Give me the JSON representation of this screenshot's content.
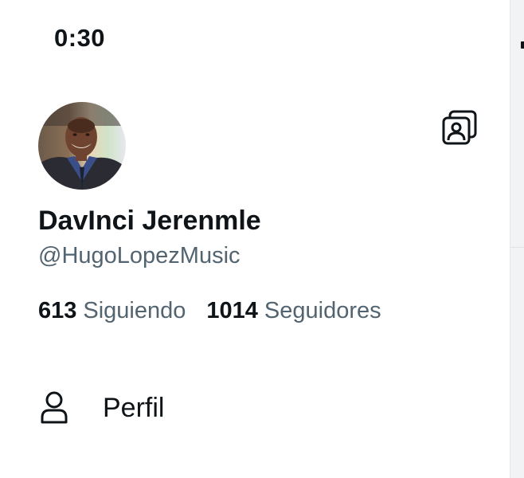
{
  "status_bar": {
    "time": "0:30"
  },
  "profile": {
    "display_name": "DavInci Jerenmle",
    "handle": "@HugoLopezMusic",
    "following_count": "613",
    "following_label": "Siguiendo",
    "followers_count": "1014",
    "followers_label": "Seguidores"
  },
  "menu": {
    "items": [
      {
        "label": "Perfil",
        "icon": "person-icon"
      }
    ]
  },
  "icons": {
    "account_switcher": "account-switcher-icon"
  },
  "colors": {
    "text_primary": "#0f1419",
    "text_secondary": "#536471",
    "background": "#ffffff"
  }
}
